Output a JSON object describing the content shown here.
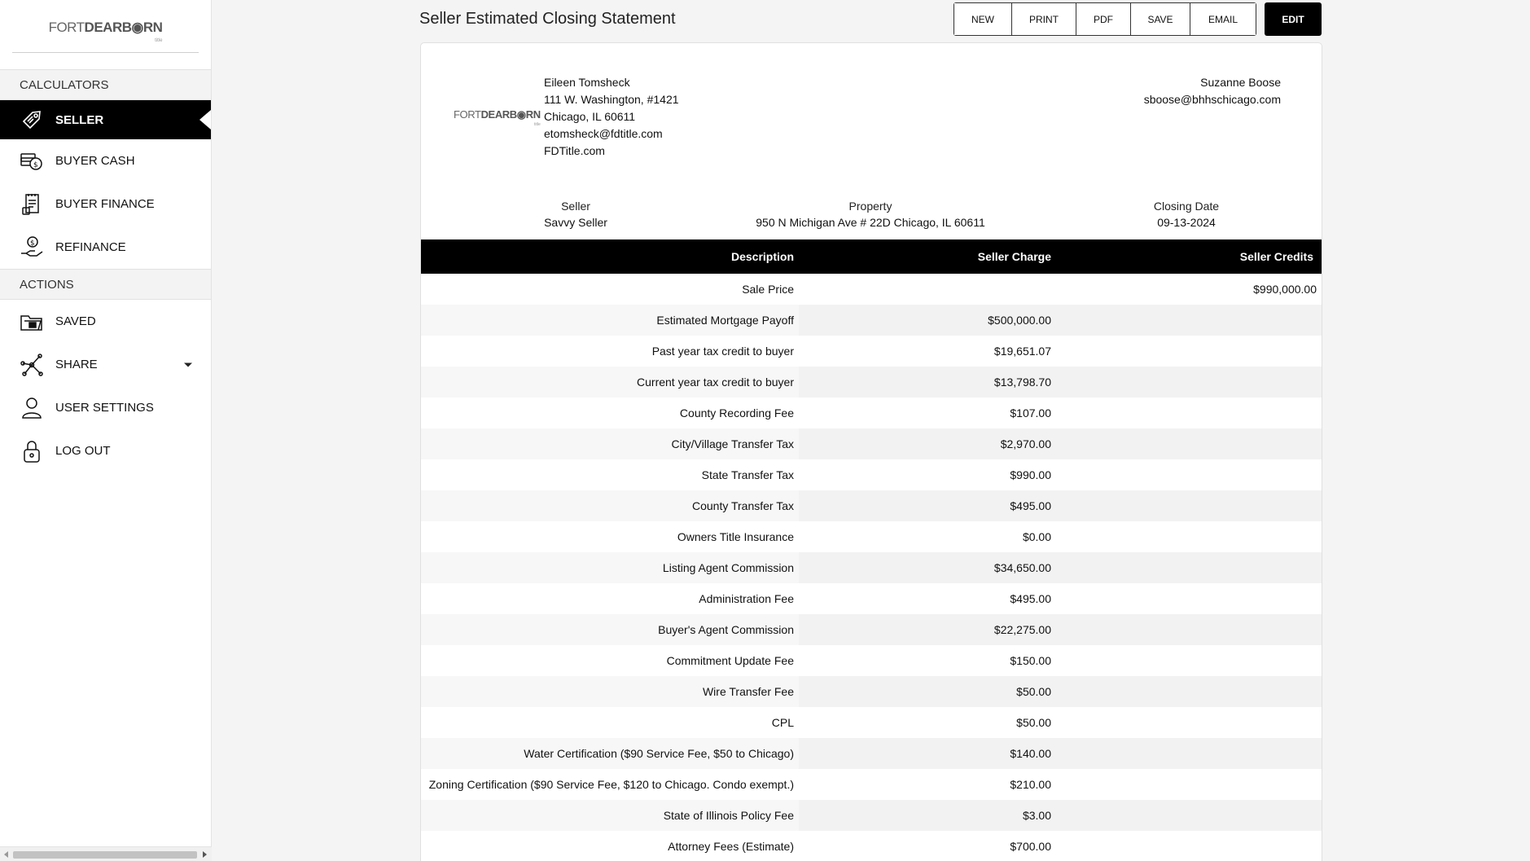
{
  "sidebar": {
    "logo": {
      "part1": "FORT",
      "part2": "DEARB",
      "part3": "RN",
      "sub": "title"
    },
    "sections": {
      "calculators": "CALCULATORS",
      "actions": "ACTIONS"
    },
    "calculators": [
      {
        "label": "SELLER",
        "icon": "price-tag-icon",
        "active": true
      },
      {
        "label": "BUYER CASH",
        "icon": "cash-coins-icon"
      },
      {
        "label": "BUYER FINANCE",
        "icon": "finance-document-icon"
      },
      {
        "label": "REFINANCE",
        "icon": "hand-dollar-icon"
      }
    ],
    "actions": [
      {
        "label": "SAVED",
        "icon": "folder-icon"
      },
      {
        "label": "SHARE",
        "icon": "share-icon"
      },
      {
        "label": "USER SETTINGS",
        "icon": "user-icon"
      },
      {
        "label": "LOG OUT",
        "icon": "lock-icon"
      }
    ]
  },
  "header": {
    "title": "Seller Estimated Closing Statement",
    "buttons": [
      "NEW",
      "PRINT",
      "PDF",
      "SAVE",
      "EMAIL"
    ],
    "edit": "EDIT"
  },
  "company": {
    "name": "Eileen Tomsheck",
    "address1": "111 W. Washington, #1421",
    "address2": "Chicago, IL 60611",
    "email": "etomsheck@fdtitle.com",
    "website": "FDTitle.com"
  },
  "agent": {
    "name": "Suzanne Boose",
    "email": "sboose@bhhschicago.com"
  },
  "info": {
    "seller_label": "Seller",
    "seller_value": "Savvy Seller",
    "property_label": "Property",
    "property_value": "950 N Michigan Ave # 22D Chicago, IL 60611",
    "closing_label": "Closing Date",
    "closing_value": "09-13-2024"
  },
  "table": {
    "headers": [
      "Description",
      "Seller Charge",
      "Seller Credits"
    ],
    "rows": [
      {
        "desc": "Sale Price",
        "charge": "",
        "credit": "$990,000.00"
      },
      {
        "desc": "Estimated Mortgage Payoff",
        "charge": "$500,000.00",
        "credit": ""
      },
      {
        "desc": "Past year tax credit to buyer",
        "charge": "$19,651.07",
        "credit": ""
      },
      {
        "desc": "Current year tax credit to buyer",
        "charge": "$13,798.70",
        "credit": ""
      },
      {
        "desc": "County Recording Fee",
        "charge": "$107.00",
        "credit": ""
      },
      {
        "desc": "City/Village Transfer Tax",
        "charge": "$2,970.00",
        "credit": ""
      },
      {
        "desc": "State Transfer Tax",
        "charge": "$990.00",
        "credit": ""
      },
      {
        "desc": "County Transfer Tax",
        "charge": "$495.00",
        "credit": ""
      },
      {
        "desc": "Owners Title Insurance",
        "charge": "$0.00",
        "credit": ""
      },
      {
        "desc": "Listing Agent Commission",
        "charge": "$34,650.00",
        "credit": ""
      },
      {
        "desc": "Administration Fee",
        "charge": "$495.00",
        "credit": ""
      },
      {
        "desc": "Buyer's Agent Commission",
        "charge": "$22,275.00",
        "credit": ""
      },
      {
        "desc": "Commitment Update Fee",
        "charge": "$150.00",
        "credit": ""
      },
      {
        "desc": "Wire Transfer Fee",
        "charge": "$50.00",
        "credit": ""
      },
      {
        "desc": "CPL",
        "charge": "$50.00",
        "credit": ""
      },
      {
        "desc": "Water Certification ($90 Service Fee, $50 to Chicago)",
        "charge": "$140.00",
        "credit": ""
      },
      {
        "desc": "Zoning Certification ($90 Service Fee, $120 to Chicago. Condo exempt.)",
        "charge": "$210.00",
        "credit": ""
      },
      {
        "desc": "State of Illinois Policy Fee",
        "charge": "$3.00",
        "credit": ""
      },
      {
        "desc": "Attorney Fees (Estimate)",
        "charge": "$700.00",
        "credit": ""
      }
    ]
  }
}
